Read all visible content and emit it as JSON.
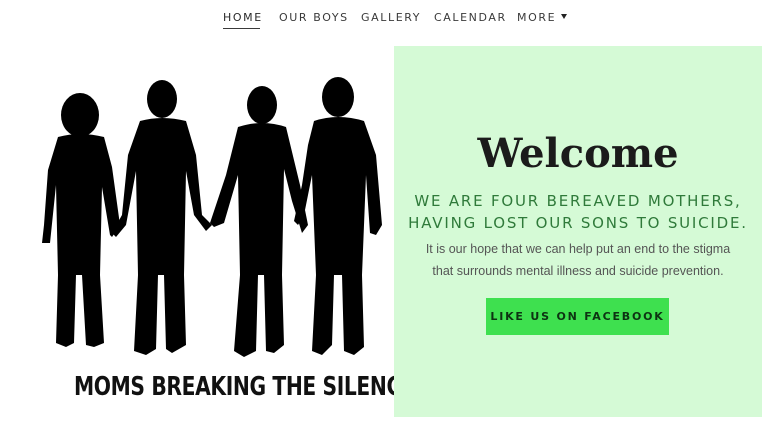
{
  "nav": {
    "items": [
      {
        "label": "HOME"
      },
      {
        "label": "OUR BOYS"
      },
      {
        "label": "GALLERY"
      },
      {
        "label": "CALENDAR"
      },
      {
        "label": "MORE"
      }
    ]
  },
  "hero": {
    "logo_text": "MOMS BREAKING THE SILENCE",
    "illustration": "four-boys-silhouette-holding-hands"
  },
  "welcome": {
    "heading": "Welcome",
    "tagline_line1": "WE ARE FOUR BEREAVED MOTHERS,",
    "tagline_line2": "HAVING LOST OUR SONS TO SUICIDE.",
    "body_line1": "It is our hope that we can help put an end to the stigma",
    "body_line2": "that surrounds mental illness and suicide prevention.",
    "button_label": "LIKE US ON FACEBOOK"
  },
  "colors": {
    "panel_bg": "#d5fad6",
    "tagline": "#2f7a3a",
    "button_bg": "#3ee04f"
  }
}
